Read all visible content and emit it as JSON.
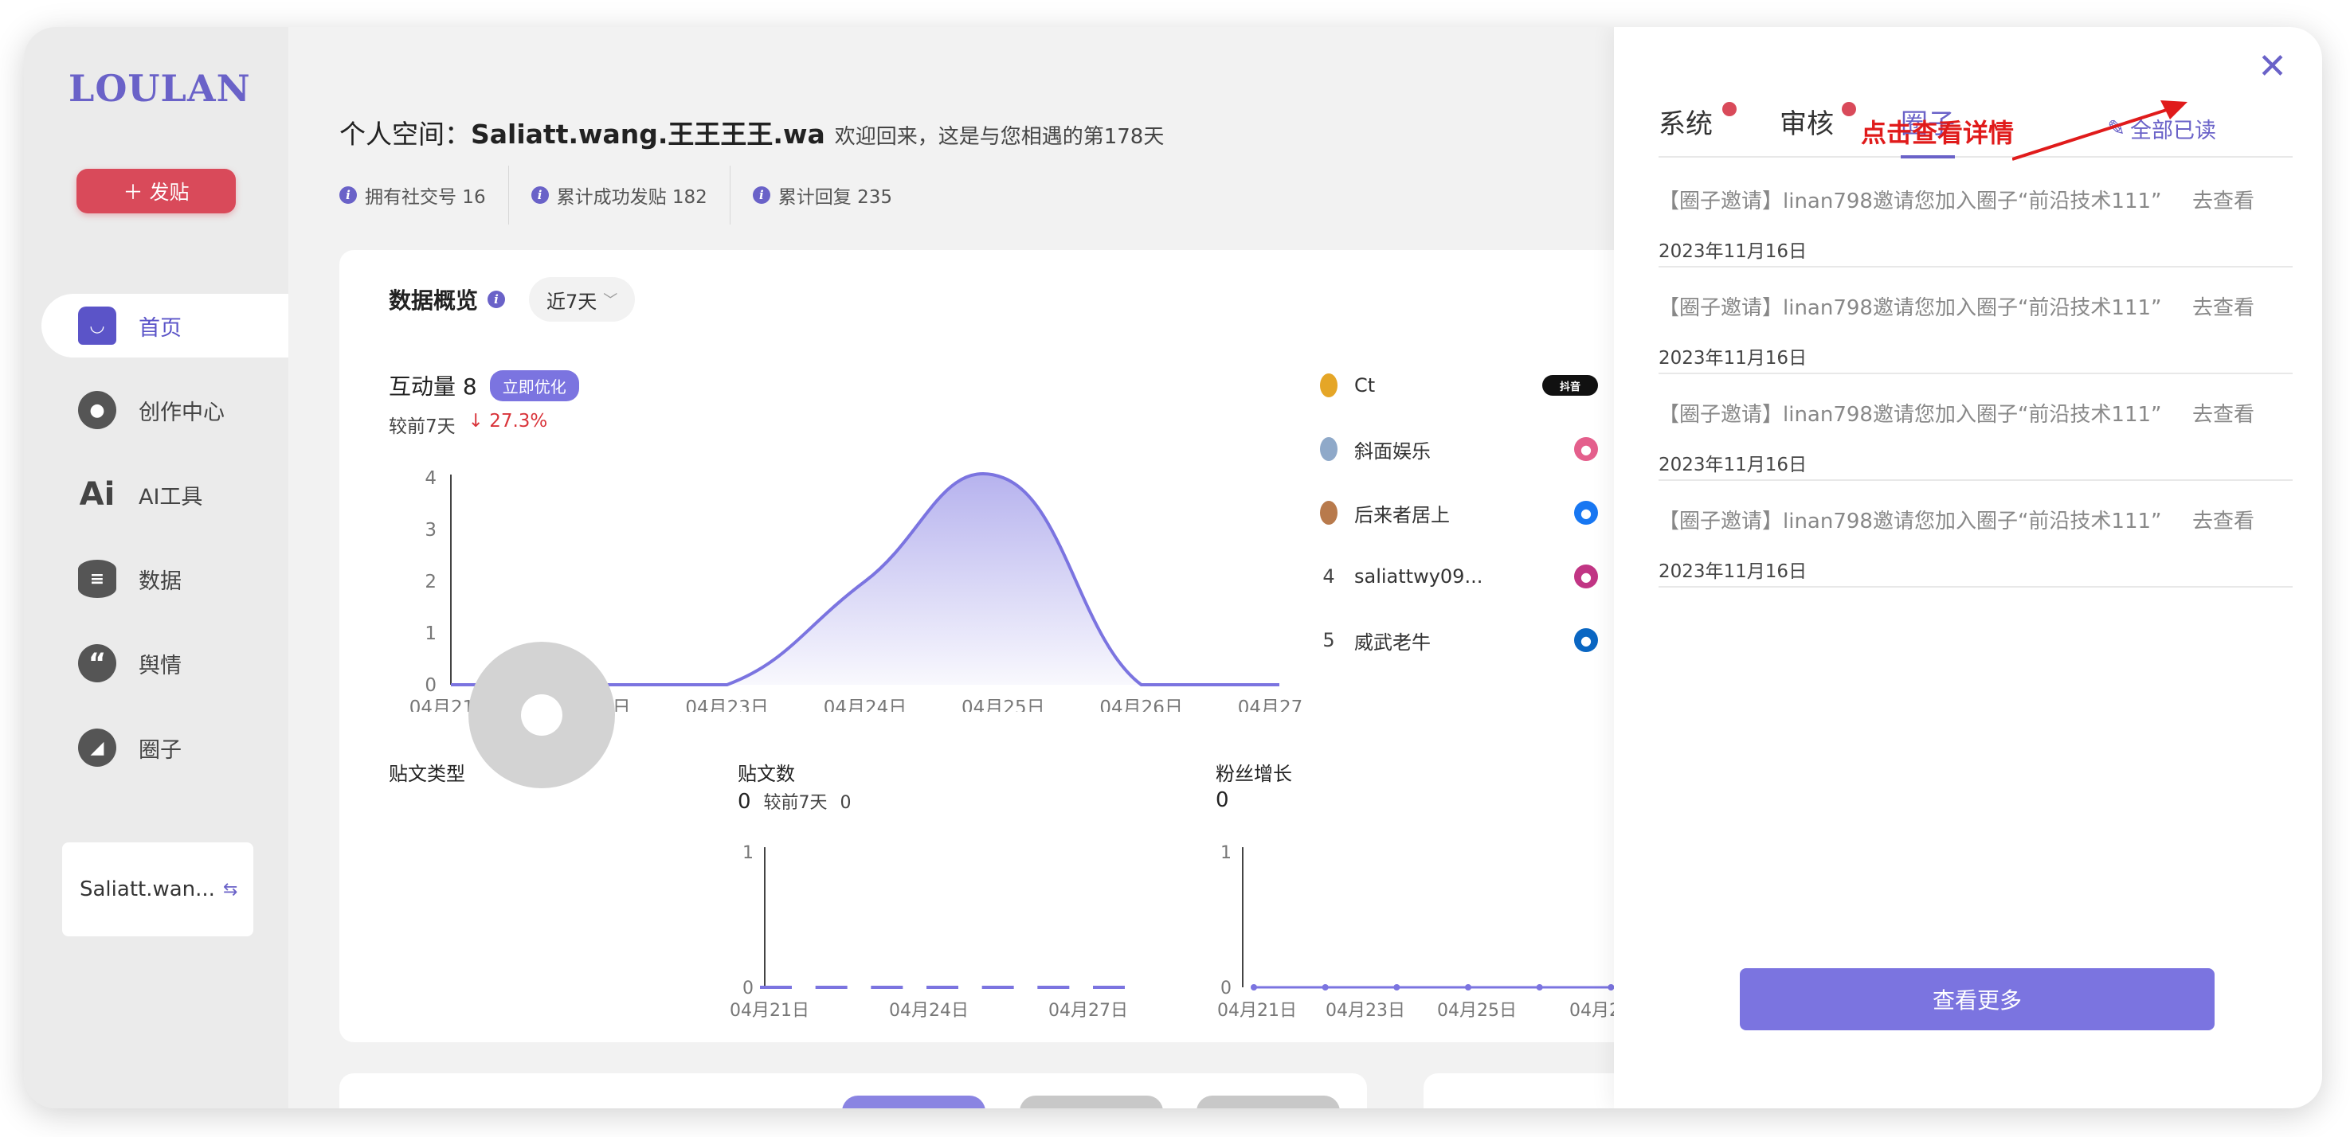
{
  "app": {
    "logo": "LOULAN"
  },
  "sidebar": {
    "post_label": "发贴",
    "items": [
      {
        "label": "首页",
        "icon": "home-icon",
        "active": true
      },
      {
        "label": "创作中心",
        "icon": "palette-icon"
      },
      {
        "label": "AI工具",
        "icon": "ai-icon",
        "glyph": "Ai"
      },
      {
        "label": "数据",
        "icon": "database-icon"
      },
      {
        "label": "舆情",
        "icon": "quote-icon",
        "glyph": "“"
      },
      {
        "label": "圈子",
        "icon": "compass-icon"
      }
    ],
    "account": "Saliatt.wan..."
  },
  "header": {
    "title_prefix": "个人空间：",
    "username": "Saliatt.wang.王王王王.wa",
    "welcome": "欢迎回来，这是与您相遇的第178天",
    "stats": [
      {
        "label": "拥有社交号 16"
      },
      {
        "label": "累计成功发贴 182"
      },
      {
        "label": "累计回复 235"
      }
    ]
  },
  "overview": {
    "title": "数据概览",
    "range": "近7天",
    "metric_label": "互动量 8",
    "optimize": "立即优化",
    "compare_label": "较前7天",
    "compare_value": "↓ 27.3%"
  },
  "chart_data": [
    {
      "type": "area",
      "title": "互动量",
      "x": [
        "04月21日",
        "04月22日",
        "04月23日",
        "04月24日",
        "04月25日",
        "04月26日",
        "04月27日"
      ],
      "series": [
        {
          "values": [
            0,
            0,
            0,
            2,
            4,
            0,
            0
          ]
        }
      ],
      "yticks": [
        0,
        1,
        2,
        3,
        4
      ],
      "ylim": [
        0,
        4
      ],
      "color": "#7b74e0"
    },
    {
      "type": "line",
      "title": "贴文数",
      "x": [
        "04月21日",
        "04月22日",
        "04月23日",
        "04月24日",
        "04月25日",
        "04月26日",
        "04月27日"
      ],
      "xticks_shown": [
        "04月21日",
        "04月24日",
        "04月27日"
      ],
      "series": [
        {
          "values": [
            0,
            0,
            0,
            0,
            0,
            0,
            0
          ]
        }
      ],
      "ylim": [
        0,
        1
      ]
    },
    {
      "type": "line",
      "title": "粉丝增长",
      "x": [
        "04月21日",
        "04月22日",
        "04月23日",
        "04月24日",
        "04月25日",
        "04月26日",
        "04月27日"
      ],
      "xticks_shown": [
        "04月21日",
        "04月23日",
        "04月25日",
        "04月2"
      ],
      "series": [
        {
          "values": [
            0,
            0,
            0,
            0,
            0,
            0,
            0
          ]
        }
      ],
      "ylim": [
        0,
        1
      ]
    }
  ],
  "ranking": [
    {
      "rank": "",
      "medal": "gold",
      "name": "Ct",
      "platform": "抖音",
      "platform_icon": "tiktok-icon"
    },
    {
      "rank": "",
      "medal": "silver",
      "name": "斜面娱乐",
      "platform_icon": "bilibili-icon",
      "platform_color": "#e45f8c"
    },
    {
      "rank": "",
      "medal": "bronze",
      "name": "后来者居上",
      "platform_icon": "facebook-icon",
      "platform_color": "#1877f2"
    },
    {
      "rank": "4",
      "name": "saliattwy09...",
      "platform_icon": "instagram-icon",
      "platform_color": "#c13584"
    },
    {
      "rank": "5",
      "name": "威武老牛",
      "platform_icon": "linkedin-icon",
      "platform_color": "#0a66c2"
    }
  ],
  "post_types": {
    "title": "贴文类型"
  },
  "post_count": {
    "title": "贴文数",
    "value": "0",
    "compare_label": "较前7天",
    "compare_value": "0"
  },
  "fans": {
    "title": "粉丝增长",
    "value": "0"
  },
  "panel": {
    "tabs": [
      "系统",
      "审核",
      "圈子"
    ],
    "mark_all_read": "全部已读",
    "notifications": [
      {
        "text": "【圈子邀请】linan798邀请您加入圈子“前沿技术111”",
        "link": "去查看",
        "date": "2023年11月16日"
      },
      {
        "text": "【圈子邀请】linan798邀请您加入圈子“前沿技术111”",
        "link": "去查看",
        "date": "2023年11月16日"
      },
      {
        "text": "【圈子邀请】linan798邀请您加入圈子“前沿技术111”",
        "link": "去查看",
        "date": "2023年11月16日"
      },
      {
        "text": "【圈子邀请】linan798邀请您加入圈子“前沿技术111”",
        "link": "去查看",
        "date": "2023年11月16日"
      }
    ],
    "annotation": "点击查看详情",
    "more": "查看更多"
  },
  "colors": {
    "accent": "#6a62c8",
    "primary_btn": "#7b74e0",
    "post_btn": "#d94a5a",
    "badge_dot": "#d94a5a",
    "annotation": "#e01b1b"
  }
}
